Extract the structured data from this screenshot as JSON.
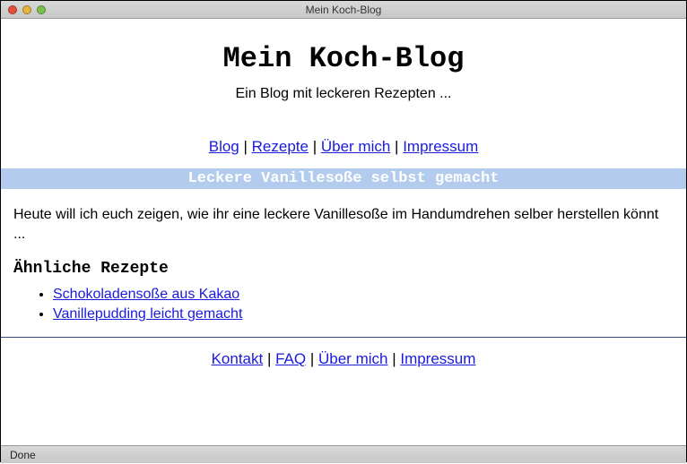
{
  "window": {
    "title": "Mein Koch-Blog",
    "status": "Done"
  },
  "header": {
    "title": "Mein Koch-Blog",
    "subtitle": "Ein Blog mit leckeren Rezepten ..."
  },
  "nav": {
    "items": [
      "Blog",
      "Rezepte",
      "Über mich",
      "Impressum"
    ],
    "separator": " | "
  },
  "article": {
    "title": "Leckere Vanillesoße selbst gemacht",
    "body": "Heute will ich euch zeigen, wie ihr eine leckere Vanillesoße im Handumdrehen selber herstellen könnt ...",
    "related_heading": "Ähnliche Rezepte",
    "related": [
      "Schokoladensoße aus Kakao",
      "Vanillepudding leicht gemacht"
    ]
  },
  "footer": {
    "items": [
      "Kontakt",
      "FAQ",
      "Über mich",
      "Impressum"
    ],
    "separator": " | "
  }
}
